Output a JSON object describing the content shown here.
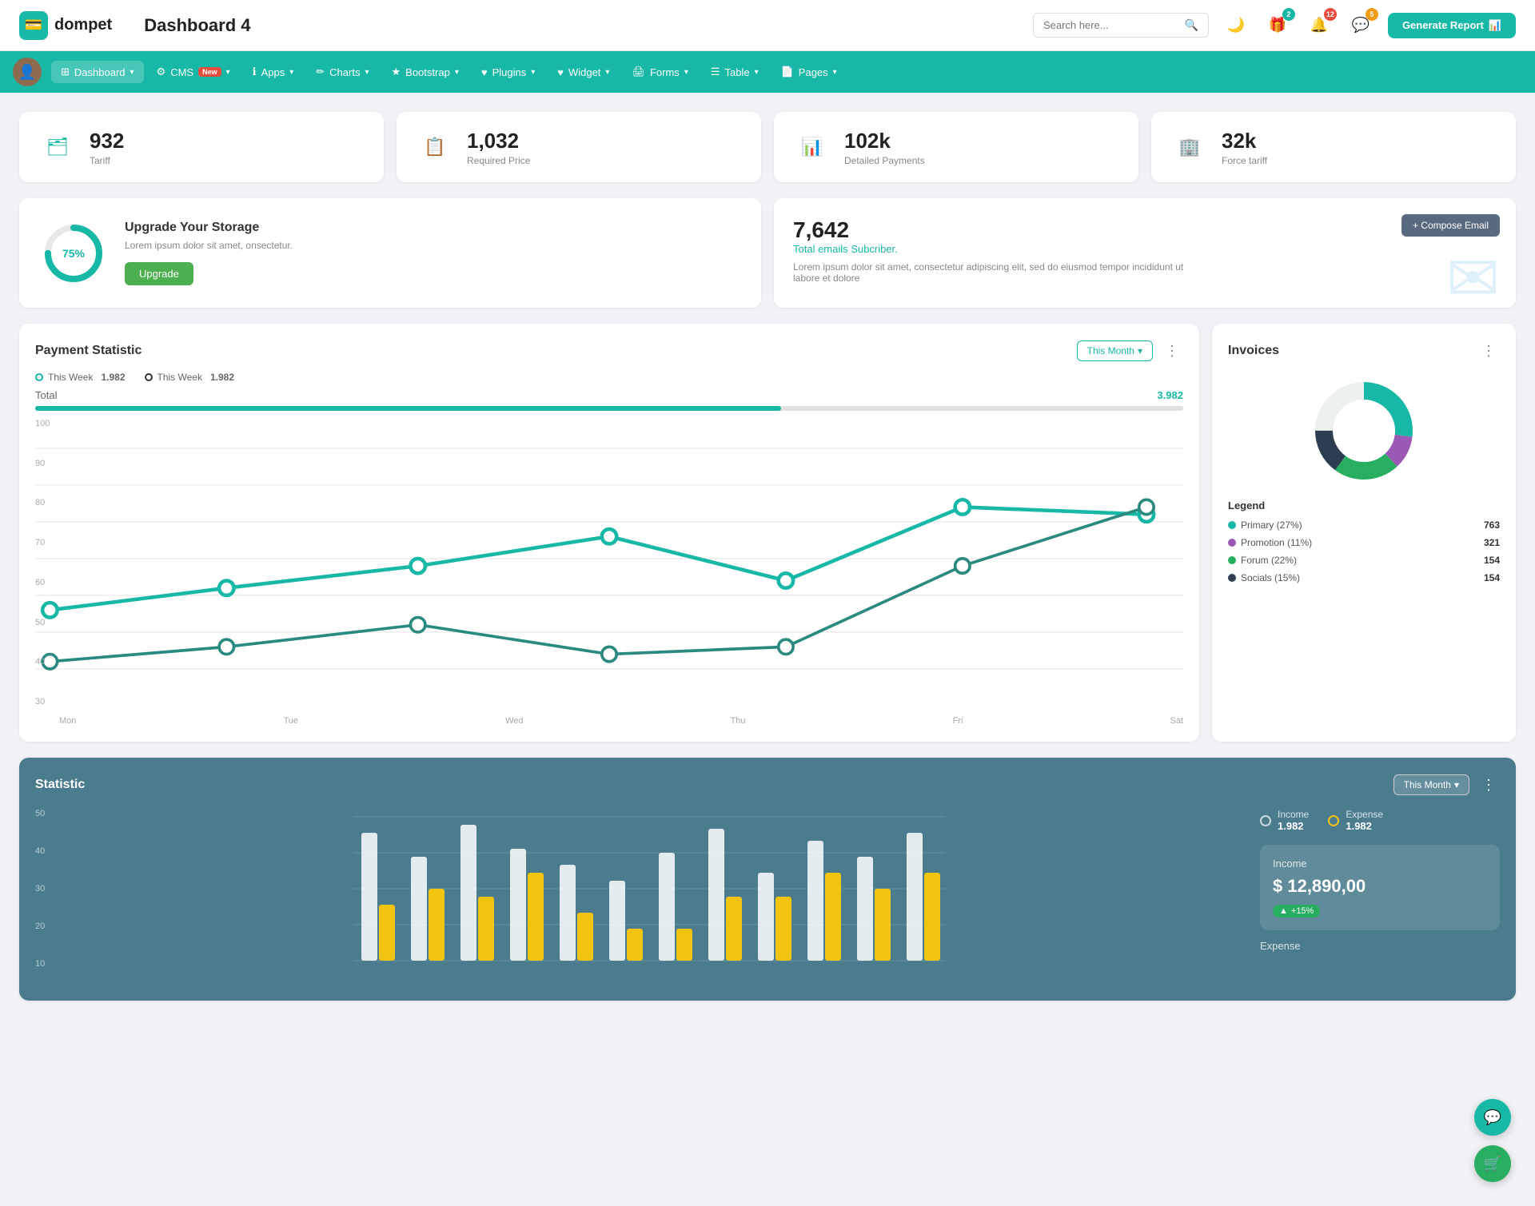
{
  "header": {
    "logo_icon": "💳",
    "logo_text": "dompet",
    "page_title": "Dashboard 4",
    "search_placeholder": "Search here...",
    "generate_report_label": "Generate Report",
    "badges": {
      "gift": "2",
      "bell": "12",
      "chat": "5"
    }
  },
  "nav": {
    "items": [
      {
        "id": "dashboard",
        "label": "Dashboard",
        "icon": "⊞",
        "has_arrow": true,
        "active": true
      },
      {
        "id": "cms",
        "label": "CMS",
        "icon": "⚙",
        "has_arrow": true,
        "badge": "New"
      },
      {
        "id": "apps",
        "label": "Apps",
        "icon": "ℹ",
        "has_arrow": true
      },
      {
        "id": "charts",
        "label": "Charts",
        "icon": "🖊",
        "has_arrow": true
      },
      {
        "id": "bootstrap",
        "label": "Bootstrap",
        "icon": "★",
        "has_arrow": true
      },
      {
        "id": "plugins",
        "label": "Plugins",
        "icon": "♥",
        "has_arrow": true
      },
      {
        "id": "widget",
        "label": "Widget",
        "icon": "♥",
        "has_arrow": true
      },
      {
        "id": "forms",
        "label": "Forms",
        "icon": "🖨",
        "has_arrow": true
      },
      {
        "id": "table",
        "label": "Table",
        "icon": "☰",
        "has_arrow": true
      },
      {
        "id": "pages",
        "label": "Pages",
        "icon": "📄",
        "has_arrow": true
      }
    ]
  },
  "stats": [
    {
      "id": "tariff",
      "number": "932",
      "label": "Tariff",
      "icon": "🗂",
      "color": "teal"
    },
    {
      "id": "required_price",
      "number": "1,032",
      "label": "Required Price",
      "icon": "📋",
      "color": "red"
    },
    {
      "id": "detailed_payments",
      "number": "102k",
      "label": "Detailed Payments",
      "icon": "📊",
      "color": "purple"
    },
    {
      "id": "force_tariff",
      "number": "32k",
      "label": "Force tariff",
      "icon": "🏢",
      "color": "pink"
    }
  ],
  "storage": {
    "percent": 75,
    "percent_label": "75%",
    "title": "Upgrade Your Storage",
    "description": "Lorem ipsum dolor sit amet, onsectetur.",
    "button_label": "Upgrade"
  },
  "email": {
    "number": "7,642",
    "subtitle": "Total emails Subcriber.",
    "description": "Lorem ipsum dolor sit amet, consectetur adipiscing elit, sed do eiusmod tempor incididunt ut labore et dolore",
    "compose_button": "+ Compose Email"
  },
  "payment_statistic": {
    "title": "Payment Statistic",
    "this_month_label": "This Month",
    "legend": [
      {
        "label": "This Week",
        "value": "1.982",
        "type": "outline-teal"
      },
      {
        "label": "This Week",
        "value": "1.982",
        "type": "outline-dark"
      }
    ],
    "total_label": "Total",
    "total_value": "3.982",
    "progress_percent": 65,
    "x_axis": [
      "Mon",
      "Tue",
      "Wed",
      "Thu",
      "Fri",
      "Sat"
    ],
    "y_axis": [
      "100",
      "90",
      "80",
      "70",
      "60",
      "50",
      "40",
      "30"
    ],
    "line1_points": "30,140 110,120 215,100 325,80 435,110 545,90 650,60 755,62",
    "line2_points": "30,160 110,155 215,145 325,160 435,155 545,155 650,100 755,60"
  },
  "invoices": {
    "title": "Invoices",
    "donut": {
      "segments": [
        {
          "label": "Primary (27%)",
          "color": "#17b8a6",
          "value": 763,
          "percent": 27
        },
        {
          "label": "Promotion (11%)",
          "color": "#9b59b6",
          "value": 321,
          "percent": 11
        },
        {
          "label": "Forum (22%)",
          "color": "#27ae60",
          "value": 154,
          "percent": 22
        },
        {
          "label": "Socials (15%)",
          "color": "#2c3e50",
          "value": 154,
          "percent": 15
        }
      ]
    }
  },
  "statistic": {
    "title": "Statistic",
    "this_month_label": "This Month",
    "income_label": "Income",
    "income_value": "1.982",
    "expense_label": "Expense",
    "expense_value": "1.982",
    "income_detail": {
      "label": "Income",
      "value": "$ 12,890,00",
      "badge": "+15%"
    },
    "expense_detail": {
      "label": "Expense"
    },
    "y_axis": [
      "50",
      "40",
      "30",
      "20",
      "10"
    ],
    "bars": [
      {
        "w": 18,
        "h1": 80,
        "h2": 30
      },
      {
        "w": 18,
        "h1": 60,
        "h2": 50
      },
      {
        "w": 18,
        "h1": 90,
        "h2": 40
      },
      {
        "w": 18,
        "h1": 70,
        "h2": 60
      },
      {
        "w": 18,
        "h1": 55,
        "h2": 35
      },
      {
        "w": 18,
        "h1": 45,
        "h2": 25
      },
      {
        "w": 18,
        "h1": 65,
        "h2": 20
      },
      {
        "w": 18,
        "h1": 88,
        "h2": 30
      },
      {
        "w": 18,
        "h1": 50,
        "h2": 40
      },
      {
        "w": 18,
        "h1": 75,
        "h2": 55
      },
      {
        "w": 18,
        "h1": 60,
        "h2": 30
      },
      {
        "w": 18,
        "h1": 85,
        "h2": 45
      }
    ]
  },
  "colors": {
    "teal": "#17b8a6",
    "accent": "#17b8a6"
  }
}
